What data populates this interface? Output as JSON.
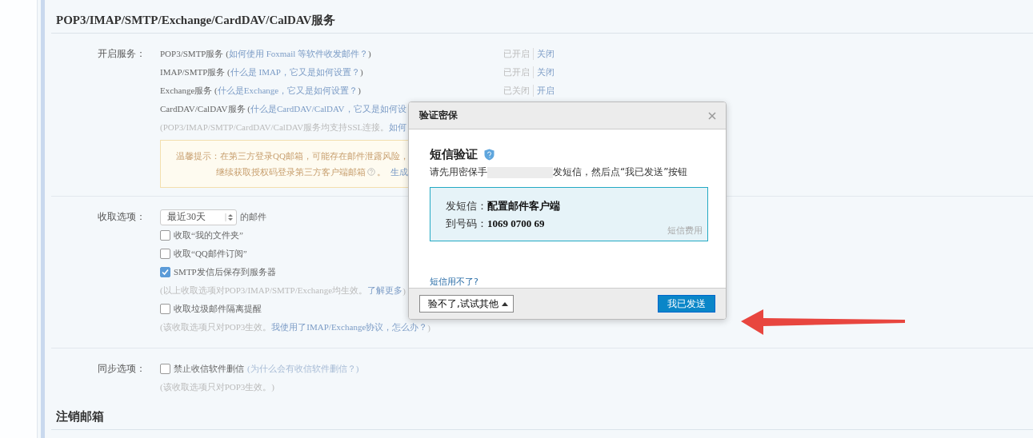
{
  "section_title": "POP3/IMAP/SMTP/Exchange/CardDAV/CalDAV服务",
  "services": {
    "label": "开启服务：",
    "items": [
      {
        "text": "POP3/SMTP服务 (",
        "link": "如何使用 Foxmail 等软件收发邮件？",
        "suffix": ")",
        "state": "已开启",
        "action": "关闭"
      },
      {
        "text": "IMAP/SMTP服务 (",
        "link": "什么是 IMAP，它又是如何设置？",
        "suffix": ")",
        "state": "已开启",
        "action": "关闭"
      },
      {
        "text": "Exchange服务 (",
        "link": "什么是Exchange，它又是如何设置？",
        "suffix": ")",
        "state": "已关闭",
        "action": "开启"
      },
      {
        "text": "CardDAV/CalDAV服务 (",
        "link": "什么是CardDAV/CalDAV，它又是如何设"
      }
    ],
    "ssl_note": {
      "text": "(POP3/IMAP/SMTP/CardDAV/CalDAV服务均支持SSL连接。",
      "link": "如何"
    },
    "tip": {
      "label": "温馨提示：",
      "line1": "在第三方登录QQ邮箱，可能存在邮件泄露风险，",
      "line2": "继续获取授权码登录第三方客户端邮箱",
      "after_icon": "。",
      "link": "生成"
    }
  },
  "fetch": {
    "label": "收取选项：",
    "select": "最近30天",
    "select_suffix": "的邮件",
    "items": [
      {
        "kind": "checkbox",
        "label": "收取“我的文件夹”",
        "checked": false
      },
      {
        "kind": "checkbox",
        "label": "收取“QQ邮件订阅”",
        "checked": false
      },
      {
        "kind": "checkbox",
        "label": "SMTP发信后保存到服务器",
        "checked": true
      },
      {
        "kind": "note",
        "text": "(以上收取选项对POP3/IMAP/SMTP/Exchange均生效。",
        "link": "了解更多",
        "suffix": ")"
      },
      {
        "kind": "checkbox",
        "label": "收取垃圾邮件隔离提醒",
        "checked": false
      },
      {
        "kind": "note",
        "text": "(该收取选项只对POP3生效。",
        "link": "我使用了IMAP/Exchange协议，怎么办？",
        "suffix": ")"
      }
    ]
  },
  "sync": {
    "label": "同步选项：",
    "items": [
      {
        "kind": "checkbox",
        "label": "禁止收信软件删信",
        "checked": false,
        "link": "(为什么会有收信软件删信？)"
      },
      {
        "kind": "note",
        "text": "(该收取选项只对POP3生效。)"
      }
    ]
  },
  "section2_title": "注销邮箱",
  "dialog": {
    "title": "验证密保",
    "heading": "短信验证",
    "instruction_before": "请先用密保手",
    "instruction_after": "发短信，然后点“我已发送”按钮",
    "sms": {
      "content_label": "发短信：",
      "content": "配置邮件客户端",
      "number_label": "到号码：",
      "number": "1069 0700 69",
      "fee_link": "短信费用"
    },
    "help_link": "短信用不了?",
    "alt_button": "验不了,试试其他",
    "confirm_button": "我已发送"
  }
}
